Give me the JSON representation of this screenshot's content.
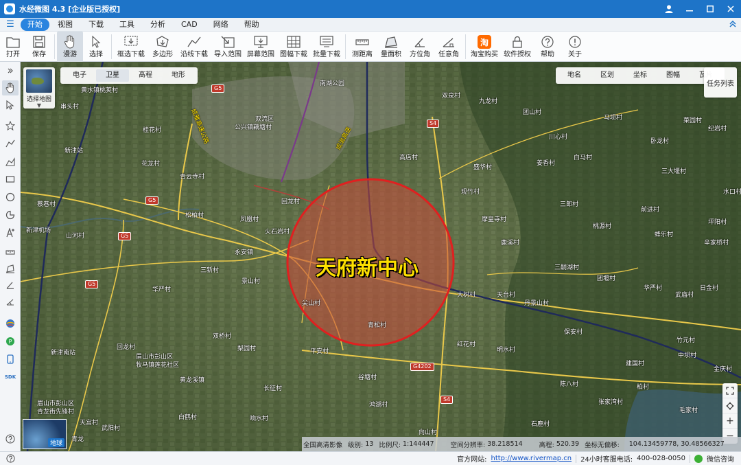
{
  "window": {
    "title": "水经微图 4.3 [企业版已授权]"
  },
  "menu": {
    "items": [
      "开始",
      "视图",
      "下载",
      "工具",
      "分析",
      "CAD",
      "网络",
      "帮助"
    ],
    "active": "开始"
  },
  "toolbar": {
    "items": [
      {
        "label": "打开",
        "icon": "folder-icon"
      },
      {
        "label": "保存",
        "icon": "save-icon"
      },
      {
        "label": "漫游",
        "icon": "hand-icon",
        "active": true
      },
      {
        "label": "选择",
        "icon": "cursor-icon"
      },
      {
        "label": "框选下载",
        "icon": "box-download-icon"
      },
      {
        "label": "多边形",
        "icon": "polygon-icon"
      },
      {
        "label": "沿线下载",
        "icon": "polyline-icon"
      },
      {
        "label": "导入范围",
        "icon": "import-icon"
      },
      {
        "label": "屏幕范围",
        "icon": "screen-icon"
      },
      {
        "label": "图幅下载",
        "icon": "grid-icon"
      },
      {
        "label": "批量下载",
        "icon": "batch-icon"
      },
      {
        "label": "测距离",
        "icon": "ruler-icon"
      },
      {
        "label": "量面积",
        "icon": "area-icon"
      },
      {
        "label": "方位角",
        "icon": "bearing-icon"
      },
      {
        "label": "任意角",
        "icon": "angle-icon"
      },
      {
        "label": "淘宝购买",
        "icon": "taobao-icon"
      },
      {
        "label": "软件授权",
        "icon": "lock-icon"
      },
      {
        "label": "帮助",
        "icon": "question-icon"
      },
      {
        "label": "关于",
        "icon": "info-icon"
      }
    ]
  },
  "map": {
    "layer_switch_label": "选择地图",
    "map_types": [
      "电子",
      "卫星",
      "高程",
      "地形"
    ],
    "active_map_type": "卫星",
    "tools": [
      "地名",
      "区划",
      "坐标",
      "图幅",
      "瓦片"
    ],
    "task_list": "任务列表",
    "globe_label": "地球",
    "highlight_label": "天府新中心",
    "places": [
      "黄水镇桃荚村",
      "串头村",
      "桂花村",
      "新津站",
      "花龙村",
      "青云寺村",
      "蔡巷村",
      "新津机场",
      "山河村",
      "松柏村",
      "凤凰村",
      "火石岩村",
      "永安镇",
      "三新村",
      "华严村",
      "景山村",
      "尖山村",
      "回龙村",
      "双桥村",
      "梨园村",
      "平安村",
      "新津南站",
      "眉山市彭山区",
      "牧马镇莲花社区",
      "眉山市彭山区",
      "青龙街先锋村",
      "黄龙溪镇",
      "长征村",
      "白鹤村",
      "响水村",
      "天宫村",
      "武阳村",
      "青龙",
      "南湖公园",
      "双流区",
      "公兴镇藕塘村",
      "回龙村",
      "高店村",
      "盛华村",
      "现竹村",
      "摩皇寺村",
      "鹿溪村",
      "大树村",
      "红花村",
      "明水村",
      "谷塘村",
      "鸿湖村",
      "青松村",
      "向山村",
      "双泉村",
      "九龙村",
      "团山村",
      "马坝村",
      "川心村",
      "白马村",
      "姜香村",
      "三郎村",
      "桃源村",
      "三嗣湖村",
      "团堰村",
      "天台村",
      "丹景山村",
      "保安村",
      "陈八村",
      "柏村",
      "张家湾村",
      "毛家村",
      "中坝村",
      "石鹿村",
      "华严村",
      "建国村",
      "竹元村",
      "菜园村",
      "卧龙村",
      "三大堰村",
      "前进村",
      "蜂乐村",
      "辛家桥村",
      "日金村",
      "武庙村",
      "水口村",
      "纪岩村",
      "坪阳村",
      "金庆村"
    ],
    "road_shields": [
      "G5",
      "G5",
      "G5",
      "G5",
      "S4",
      "S4",
      "G4202"
    ],
    "road_labels": [
      "成雅高速公路",
      "成渝高速"
    ]
  },
  "infobar": {
    "source": "全国高清影像",
    "level_label": "级别:",
    "level": "13",
    "scale_label": "比例尺:",
    "scale": "1:144447",
    "resolution_label": "空间分辨率:",
    "resolution": "38.218514",
    "elevation_label": "高程:",
    "elevation": "520.39",
    "coord_label": "坐标无偏移:",
    "coords": "104.13459778, 30.48566327"
  },
  "statusbar": {
    "website_label": "官方网站:",
    "website": "http://www.rivermap.cn",
    "phone_label": "24小时客服电话:",
    "phone": "400-028-0050",
    "wechat": "微信咨询"
  },
  "colors": {
    "titlebar": "#1e74c8",
    "menu_active": "#2a84df",
    "circle_fill": "#c84a3a",
    "circle_stroke": "#e02020",
    "label_yellow": "#ffe100",
    "road_yellow": "#e9c84a"
  }
}
